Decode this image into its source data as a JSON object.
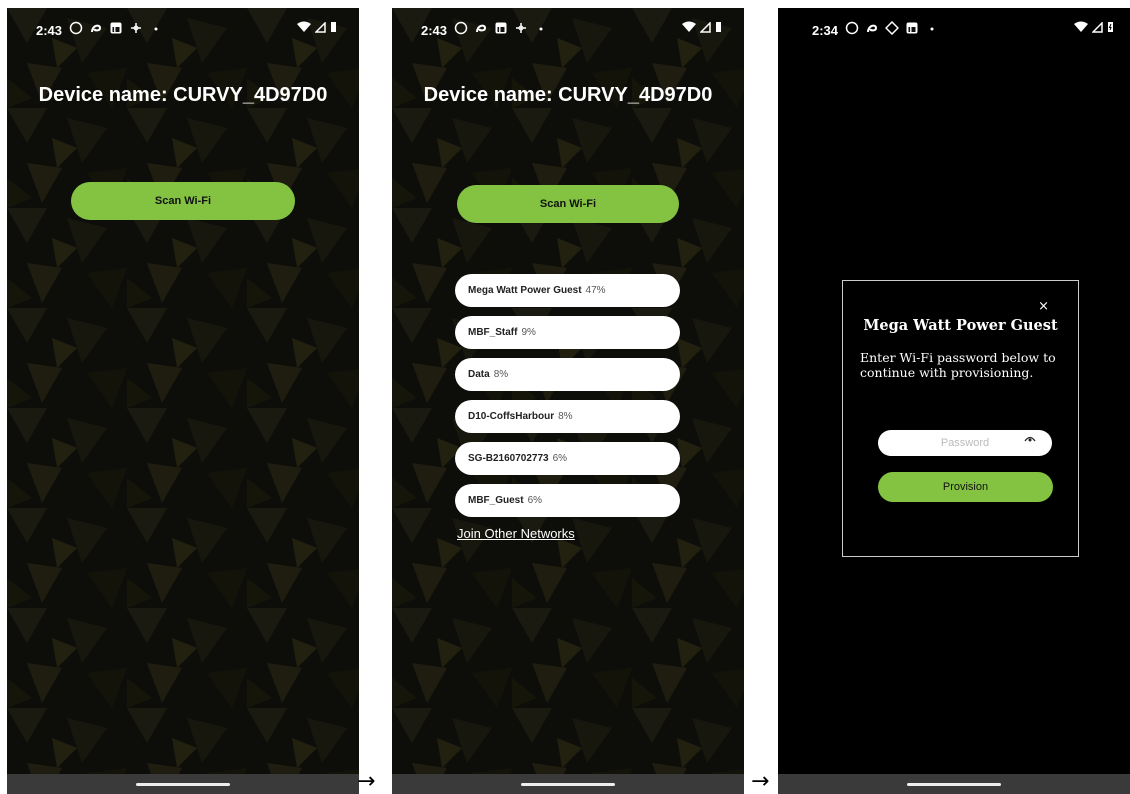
{
  "screens": [
    {
      "status": {
        "time": "2:43"
      },
      "device_title": "Device name: CURVY_4D97D0",
      "scan_label": "Scan Wi-Fi"
    },
    {
      "status": {
        "time": "2:43"
      },
      "device_title": "Device name: CURVY_4D97D0",
      "scan_label": "Scan Wi-Fi",
      "networks": [
        {
          "ssid": "Mega Watt Power Guest",
          "signal": "47%"
        },
        {
          "ssid": "MBF_Staff",
          "signal": "9%"
        },
        {
          "ssid": "Data",
          "signal": "8%"
        },
        {
          "ssid": "D10-CoffsHarbour",
          "signal": "8%"
        },
        {
          "ssid": "SG-B2160702773",
          "signal": "6%"
        },
        {
          "ssid": "MBF_Guest",
          "signal": "6%"
        }
      ],
      "join_other_label": "Join Other Networks"
    },
    {
      "status": {
        "time": "2:34"
      },
      "dialog": {
        "close_label": "×",
        "title": "Mega Watt Power Guest",
        "message": "Enter Wi-Fi password below to continue with provisioning.",
        "password_placeholder": "Password",
        "provision_label": "Provision"
      }
    }
  ],
  "arrows": [
    "→",
    "→"
  ],
  "colors": {
    "accent": "#84c341",
    "background": "#0b0b09",
    "text": "#ffffff"
  },
  "icons": [
    "whatsapp-icon",
    "chat-icon",
    "linkedin-icon",
    "fan-icon",
    "wifi-icon",
    "signal-icon",
    "battery-icon",
    "eye-icon"
  ]
}
